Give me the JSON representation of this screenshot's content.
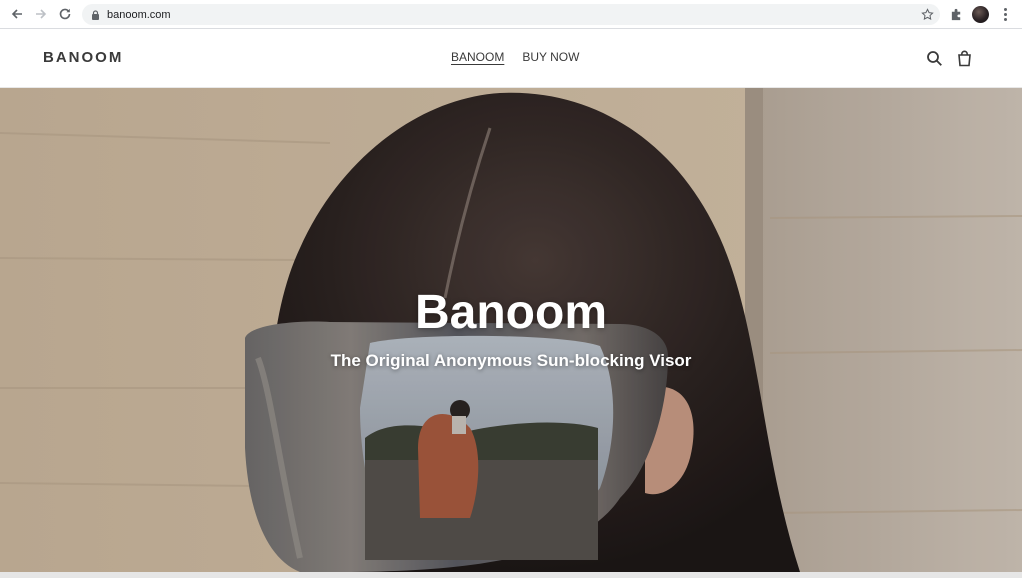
{
  "browser": {
    "url": "banoom.com",
    "icons": {
      "back": "arrow-left-icon",
      "forward": "arrow-right-icon",
      "reload": "reload-icon",
      "lock": "lock-icon",
      "bookmark": "star-icon",
      "extensions": "puzzle-icon",
      "menu": "kebab-menu-icon"
    }
  },
  "header": {
    "logo": "BANOOM",
    "nav": [
      {
        "label": "BANOOM",
        "active": true
      },
      {
        "label": "BUY NOW",
        "active": false
      }
    ],
    "icons": {
      "search": "search-icon",
      "cart": "shopping-bag-icon"
    }
  },
  "hero": {
    "title": "Banoom",
    "subtitle": "The Original Anonymous Sun-blocking Visor"
  },
  "colors": {
    "text_dark": "#3a3a3a",
    "hero_text": "#ffffff",
    "omnibox_bg": "#f1f3f4"
  }
}
